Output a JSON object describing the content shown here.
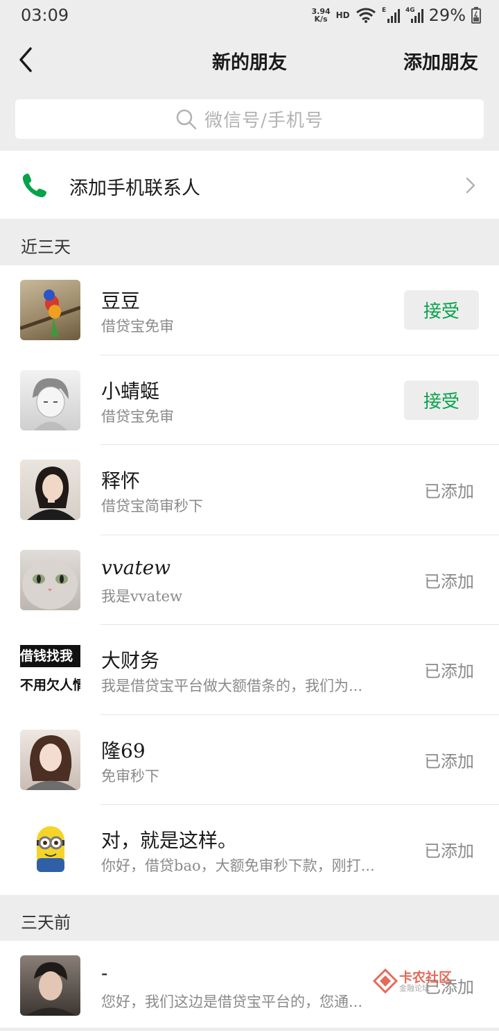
{
  "status_bar": {
    "time": "03:09",
    "net_speed_value": "3.94",
    "net_speed_unit": "K/s",
    "hd": "HD",
    "network_type_1": "E",
    "network_type_2": "4G",
    "battery": "29%"
  },
  "nav": {
    "title": "新的朋友",
    "add_friend": "添加朋友"
  },
  "search": {
    "placeholder": "微信号/手机号"
  },
  "phone_contacts": {
    "label": "添加手机联系人"
  },
  "sections": [
    {
      "title": "近三天",
      "items": [
        {
          "name": "豆豆",
          "message": "借贷宝免审",
          "status": "接受",
          "accept": true
        },
        {
          "name": "小蜻蜓",
          "message": "借贷宝免审",
          "status": "接受",
          "accept": true
        },
        {
          "name": "释怀",
          "message": "借贷宝简审秒下",
          "status": "已添加",
          "accept": false
        },
        {
          "name": "vvatew",
          "message": "我是vvatew",
          "status": "已添加",
          "accept": false
        },
        {
          "name": "大财务",
          "message": "我是借贷宝平台做大额借条的，我们为...",
          "status": "已添加",
          "accept": false
        },
        {
          "name": "隆69",
          "message": "免审秒下",
          "status": "已添加",
          "accept": false
        },
        {
          "name": "对，就是这样。",
          "message": "你好，借贷bao，大额免审秒下款，刚打...",
          "status": "已添加",
          "accept": false
        }
      ]
    },
    {
      "title": "三天前",
      "items": [
        {
          "name": "-",
          "message": "您好，我们这边是借贷宝平台的，您通...",
          "status": "已添加",
          "accept": false
        }
      ]
    }
  ],
  "avatar_text": {
    "line1": "借钱找我",
    "line2": "不用欠人情"
  },
  "watermark": {
    "text": "卡农社区",
    "sub": "金融论坛"
  },
  "colors": {
    "accent_green": "#07a34a",
    "background": "#ededed"
  }
}
